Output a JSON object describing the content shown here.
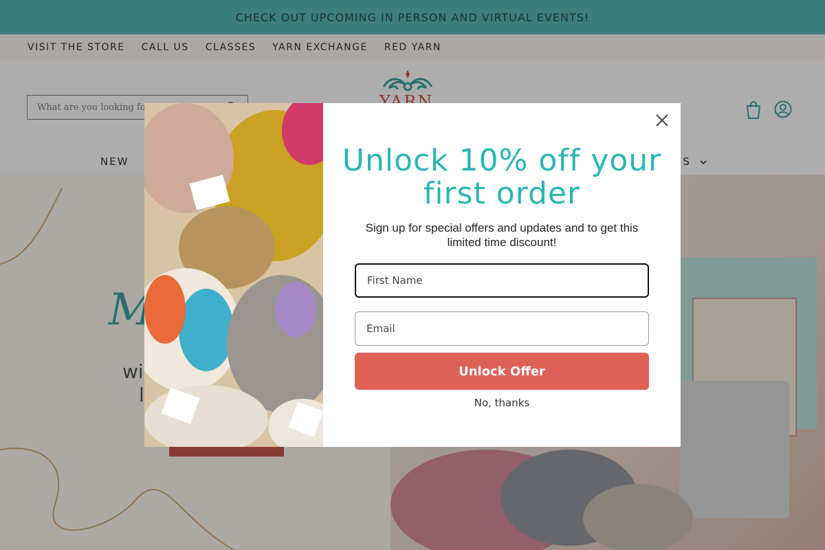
{
  "announcement": {
    "text": "CHECK OUT UPCOMING IN PERSON AND VIRTUAL EVENTS!"
  },
  "utility_nav": {
    "items": [
      {
        "label": "VISIT THE STORE"
      },
      {
        "label": "CALL US"
      },
      {
        "label": "CLASSES"
      },
      {
        "label": "YARN EXCHANGE"
      },
      {
        "label": "RED YARN"
      }
    ]
  },
  "header": {
    "search_placeholder": "What are you looking for?",
    "logo_text": "YARN",
    "icons": [
      "cart-icon",
      "account-icon"
    ]
  },
  "main_nav": {
    "first_item": "NEW",
    "partial_item": "NS"
  },
  "hero": {
    "title": "M",
    "subtitle_line1": "wi",
    "subtitle_line2": "l"
  },
  "modal": {
    "headline": "Unlock 10% off your first order",
    "subtext": "Sign up for special offers and updates and to get this limited time discount!",
    "first_name_placeholder": "First Name",
    "email_placeholder": "Email",
    "unlock_label": "Unlock Offer",
    "decline_label": "No, thanks"
  },
  "colors": {
    "announcement_bg": "#49b3b3",
    "headline": "#2bb5b5",
    "unlock_button": "#de6156",
    "brand_red": "#c8473f"
  }
}
